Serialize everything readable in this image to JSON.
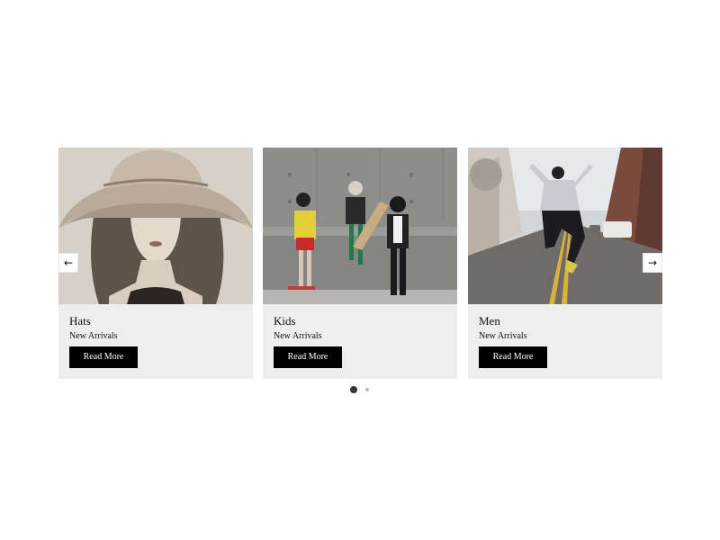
{
  "carousel": {
    "prev_arrow": "←",
    "next_arrow": "→",
    "cards": [
      {
        "title": "Hats",
        "subtitle": "New Arrivals",
        "button_label": "Read More",
        "image": "woman-in-wide-brim-hat"
      },
      {
        "title": "Kids",
        "subtitle": "New Arrivals",
        "button_label": "Read More",
        "image": "kids-posing-by-concrete-wall"
      },
      {
        "title": "Men",
        "subtitle": "New Arrivals",
        "button_label": "Read More",
        "image": "man-jumping-on-street"
      }
    ],
    "pagination": {
      "count": 2,
      "active": 1
    }
  },
  "colors": {
    "card_background": "#efeeee",
    "button_background": "#000000",
    "button_text": "#ffffff",
    "dot_active": "#333333",
    "dot_inactive": "#bbbbbb"
  }
}
